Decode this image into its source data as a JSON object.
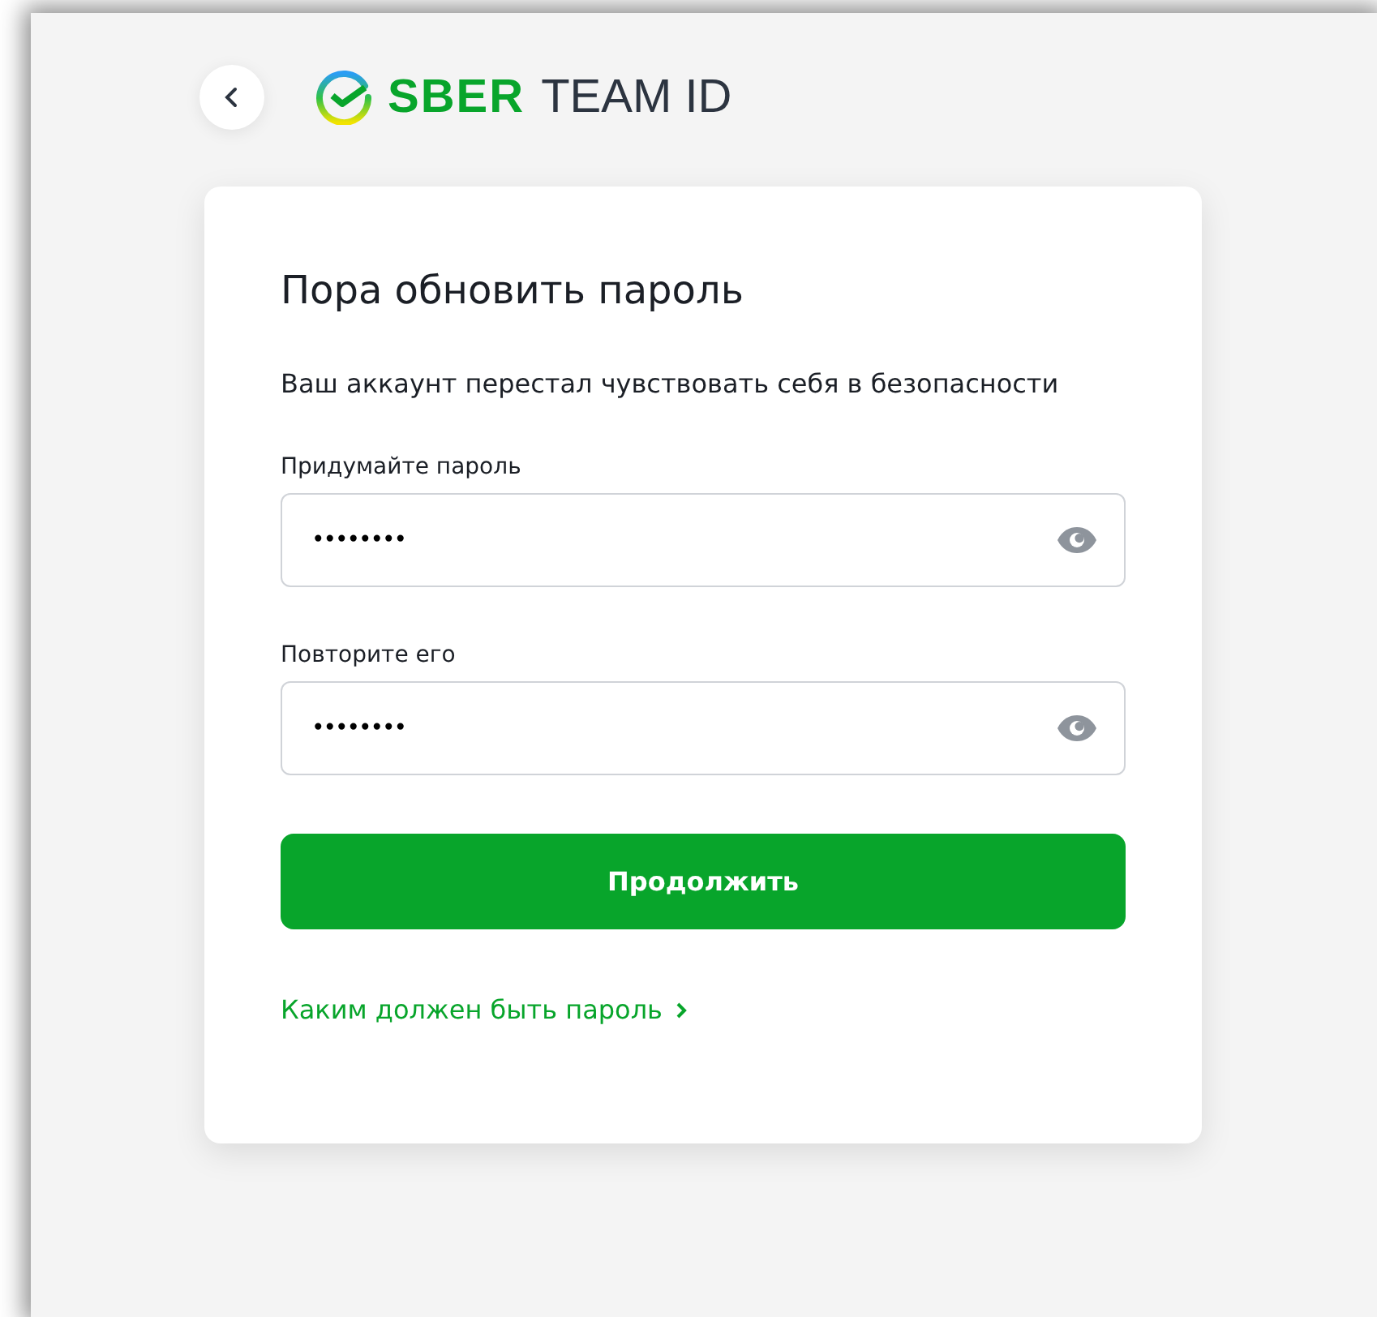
{
  "header": {
    "logo": {
      "brand": "SBER",
      "product": "TEAM ID"
    }
  },
  "card": {
    "title": "Пора обновить пароль",
    "subtitle": "Ваш аккаунт перестал чувствовать себя в безопасности",
    "fields": [
      {
        "label": "Придумайте пароль",
        "value": "••••••••"
      },
      {
        "label": "Повторите его",
        "value": "••••••••"
      }
    ],
    "submit": "Продолжить",
    "link": "Каким должен быть пароль"
  }
}
